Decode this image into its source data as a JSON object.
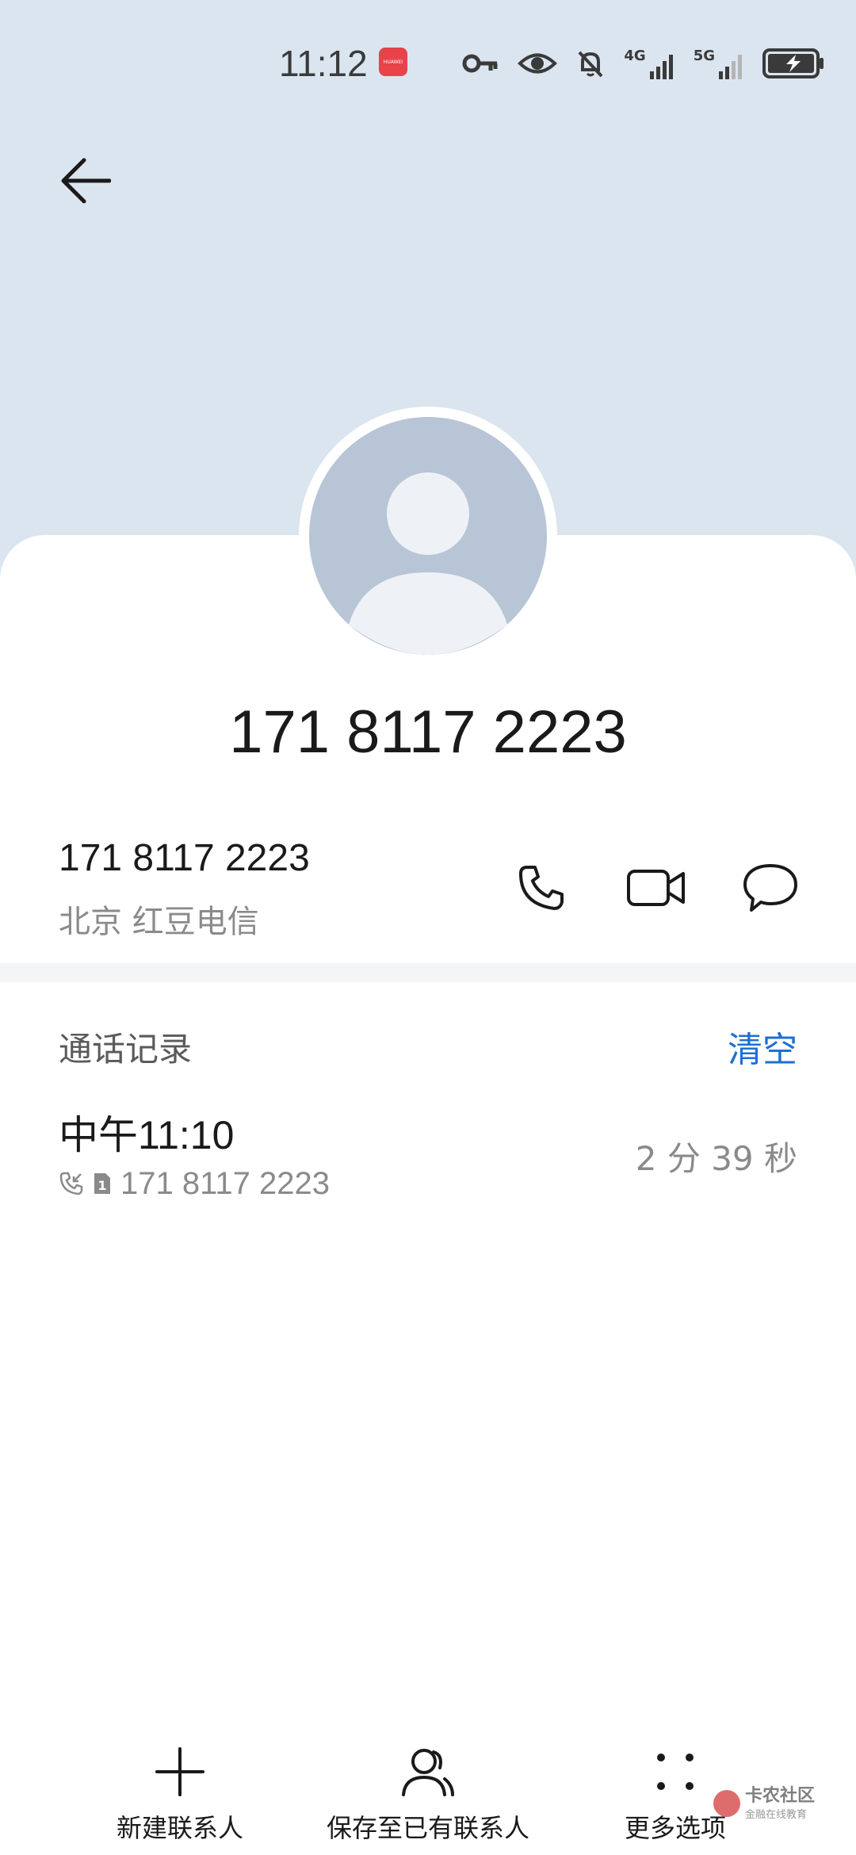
{
  "status_bar": {
    "time": "11:12",
    "app_badge_label": "HUAWEI",
    "network_4g": "4G",
    "network_5g": "5G"
  },
  "contact": {
    "title": "171 8117 2223",
    "number": "171 8117 2223",
    "location": "北京 红豆电信"
  },
  "call_log": {
    "section_title": "通话记录",
    "clear_label": "清空",
    "entries": [
      {
        "time": "中午11:10",
        "sim": "1",
        "number": "171 8117 2223",
        "duration": "2 分 39 秒"
      }
    ]
  },
  "toolbar": {
    "new_contact": "新建联系人",
    "save_to_existing": "保存至已有联系人",
    "more_options": "更多选项"
  },
  "watermark": {
    "text": "卡农社区",
    "sub": "金融在线教育"
  },
  "colors": {
    "header_bg": "#dbe5f0",
    "accent": "#1f6fd1",
    "avatar_bg": "#b8c5d6"
  }
}
